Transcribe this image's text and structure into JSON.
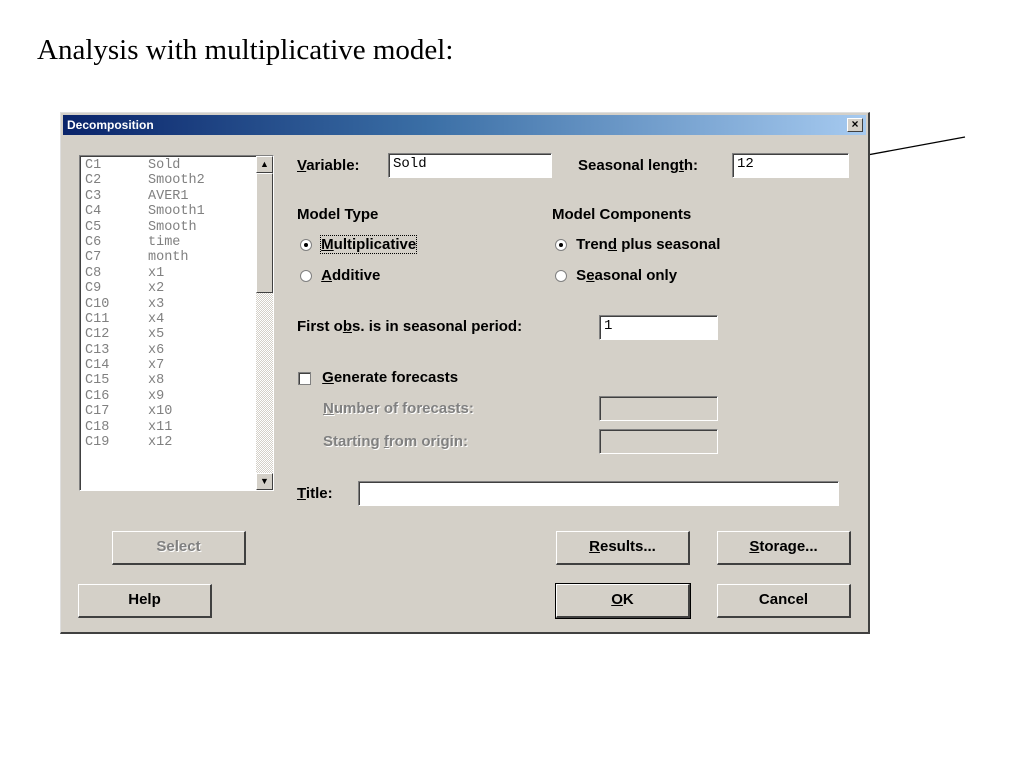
{
  "slide": {
    "title": "Analysis with multiplicative model:"
  },
  "dialog": {
    "title": "Decomposition",
    "close_glyph": "×",
    "columns": [
      {
        "id": "C1",
        "name": "Sold"
      },
      {
        "id": "C2",
        "name": "Smooth2"
      },
      {
        "id": "C3",
        "name": "AVER1"
      },
      {
        "id": "C4",
        "name": "Smooth1"
      },
      {
        "id": "C5",
        "name": "Smooth"
      },
      {
        "id": "C6",
        "name": "time"
      },
      {
        "id": "C7",
        "name": "month"
      },
      {
        "id": "C8",
        "name": "x1"
      },
      {
        "id": "C9",
        "name": "x2"
      },
      {
        "id": "C10",
        "name": "x3"
      },
      {
        "id": "C11",
        "name": "x4"
      },
      {
        "id": "C12",
        "name": "x5"
      },
      {
        "id": "C13",
        "name": "x6"
      },
      {
        "id": "C14",
        "name": "x7"
      },
      {
        "id": "C15",
        "name": "x8"
      },
      {
        "id": "C16",
        "name": "x9"
      },
      {
        "id": "C17",
        "name": "x10"
      },
      {
        "id": "C18",
        "name": "x11"
      },
      {
        "id": "C19",
        "name": "x12"
      }
    ],
    "variable": {
      "label_pre": "",
      "label_key": "V",
      "label_post": "ariable:",
      "value": "Sold"
    },
    "seasonal": {
      "label_pre": "Seasonal leng",
      "label_key": "t",
      "label_post": "h:",
      "value": "12"
    },
    "model_type": {
      "heading": "Model Type",
      "multiplicative": {
        "key": "M",
        "rest": "ultiplicative",
        "selected": true
      },
      "additive": {
        "key": "A",
        "rest": "dditive",
        "selected": false
      }
    },
    "model_components": {
      "heading": "Model Components",
      "trend": {
        "pre": "Tren",
        "key": "d",
        "post": " plus seasonal",
        "selected": true
      },
      "seasonal_only": {
        "pre": "S",
        "key": "e",
        "post": "asonal only",
        "selected": false
      }
    },
    "first_obs": {
      "pre": "First o",
      "key": "b",
      "post": "s. is in seasonal period:",
      "value": "1"
    },
    "forecasts": {
      "key": "G",
      "rest": "enerate forecasts",
      "checked": false,
      "number": {
        "key": "N",
        "rest": "umber of forecasts:"
      },
      "origin": {
        "pre": "Starting ",
        "key": "f",
        "post": "rom origin:"
      }
    },
    "title_field": {
      "key": "T",
      "rest": "itle:",
      "value": ""
    },
    "buttons": {
      "select": "Select",
      "help": "Help",
      "results": {
        "key": "R",
        "rest": "esults..."
      },
      "storage": {
        "key": "S",
        "rest": "torage..."
      },
      "ok": {
        "key": "O",
        "rest": "K"
      },
      "cancel": "Cancel"
    }
  }
}
